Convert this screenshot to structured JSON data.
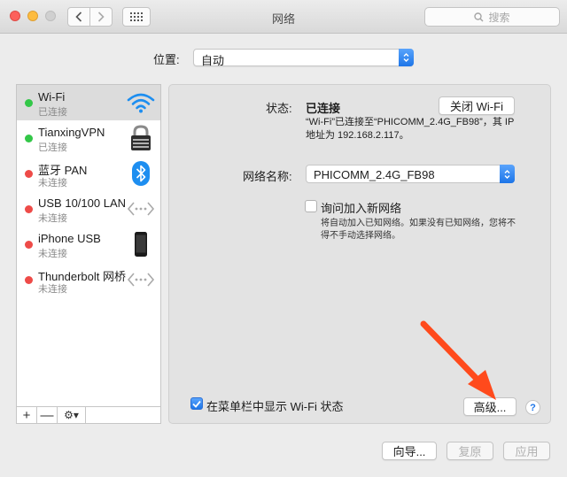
{
  "window": {
    "title": "网络"
  },
  "search": {
    "placeholder": "搜索",
    "icon": "search-icon"
  },
  "location": {
    "label": "位置:",
    "value": "自动"
  },
  "services": [
    {
      "name": "Wi-Fi",
      "status": "已连接",
      "dot_color": "#33c748",
      "icon": "wifi-icon",
      "selected": true
    },
    {
      "name": "TianxingVPN",
      "status": "已连接",
      "dot_color": "#33c748",
      "icon": "vpn-lock-icon",
      "selected": false
    },
    {
      "name": "蓝牙 PAN",
      "status": "未连接",
      "dot_color": "#ee4b48",
      "icon": "bluetooth-icon",
      "selected": false
    },
    {
      "name": "USB 10/100 LAN",
      "status": "未连接",
      "dot_color": "#ee4b48",
      "icon": "ethernet-icon",
      "selected": false
    },
    {
      "name": "iPhone USB",
      "status": "未连接",
      "dot_color": "#ee4b48",
      "icon": "iphone-icon",
      "selected": false
    },
    {
      "name": "Thunderbolt 网桥",
      "status": "未连接",
      "dot_color": "#ee4b48",
      "icon": "ethernet-icon",
      "selected": false
    }
  ],
  "sidebar_tools": {
    "add": "+",
    "remove": "—",
    "gear": "⚙▾"
  },
  "detail": {
    "status_label": "状态:",
    "status_value": "已连接",
    "wifi_off_button": "关闭 Wi-Fi",
    "status_desc": "“Wi-Fi”已连接至“PHICOMM_2.4G_FB98”，其 IP 地址为 192.168.2.117。",
    "network_name_label": "网络名称:",
    "network_name_value": "PHICOMM_2.4G_FB98",
    "ask_join_label": "询问加入新网络",
    "ask_join_checked": false,
    "ask_join_desc": "将自动加入已知网络。如果没有已知网络，您将不得不手动选择网络。",
    "show_menubar_label": "在菜单栏中显示 Wi-Fi 状态",
    "show_menubar_checked": true,
    "advanced_button": "高级...",
    "help_button": "?"
  },
  "footer": {
    "assistant_button": "向导...",
    "revert_button": "复原",
    "apply_button": "应用"
  },
  "colors": {
    "accent": "#1d75e8",
    "annotation_arrow": "#ff4a1c"
  }
}
